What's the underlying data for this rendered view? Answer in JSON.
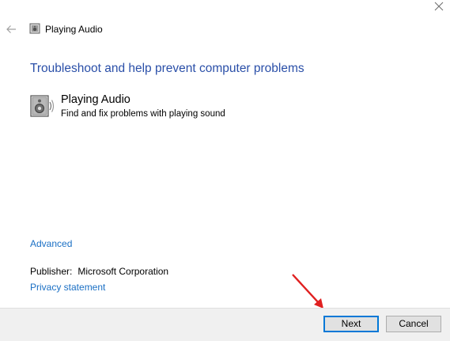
{
  "header": {
    "title": "Playing Audio"
  },
  "main": {
    "heading": "Troubleshoot and help prevent computer problems",
    "item": {
      "title": "Playing Audio",
      "description": "Find and fix problems with playing sound",
      "icon": "speaker-icon"
    },
    "advanced_link": "Advanced",
    "publisher_label": "Publisher:",
    "publisher_value": "Microsoft Corporation",
    "privacy_link": "Privacy statement"
  },
  "footer": {
    "next_label": "Next",
    "cancel_label": "Cancel"
  },
  "colors": {
    "heading": "#2a4fa8",
    "link": "#1a6fc4",
    "focus_border": "#0078d7",
    "annotation_arrow": "#e02020"
  }
}
